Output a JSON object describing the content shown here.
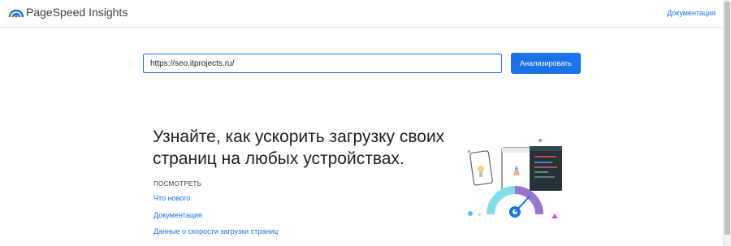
{
  "header": {
    "app_title": "PageSpeed Insights",
    "docs_link": "Документация"
  },
  "search": {
    "url_value": "https://seo.itprojects.ru/",
    "analyze_label": "Анализировать"
  },
  "hero": {
    "headline": "Узнайте, как ускорить загрузку своих страниц на любых устройствах.",
    "see_label": "ПОСМОТРЕТЬ",
    "links": [
      "Что нового",
      "Документация",
      "Данные о скорости загрузки страниц"
    ]
  },
  "icons": {
    "logo": "pagespeed-logo-icon",
    "illustration": "speed-gauge-illustration"
  },
  "colors": {
    "accent": "#1a73e8",
    "text": "#202124"
  }
}
